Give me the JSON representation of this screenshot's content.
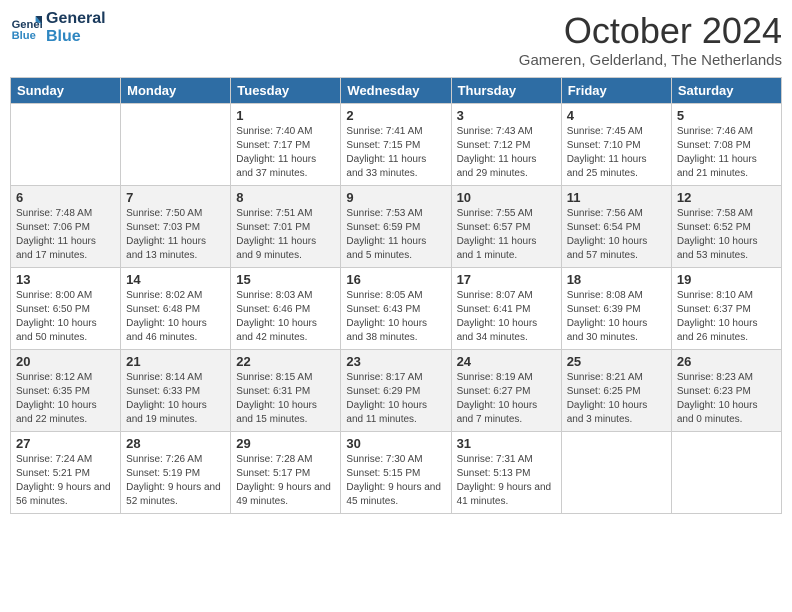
{
  "header": {
    "logo_line1": "General",
    "logo_line2": "Blue",
    "month": "October 2024",
    "location": "Gameren, Gelderland, The Netherlands"
  },
  "days_of_week": [
    "Sunday",
    "Monday",
    "Tuesday",
    "Wednesday",
    "Thursday",
    "Friday",
    "Saturday"
  ],
  "weeks": [
    [
      {
        "day": "",
        "info": ""
      },
      {
        "day": "",
        "info": ""
      },
      {
        "day": "1",
        "info": "Sunrise: 7:40 AM\nSunset: 7:17 PM\nDaylight: 11 hours and 37 minutes."
      },
      {
        "day": "2",
        "info": "Sunrise: 7:41 AM\nSunset: 7:15 PM\nDaylight: 11 hours and 33 minutes."
      },
      {
        "day": "3",
        "info": "Sunrise: 7:43 AM\nSunset: 7:12 PM\nDaylight: 11 hours and 29 minutes."
      },
      {
        "day": "4",
        "info": "Sunrise: 7:45 AM\nSunset: 7:10 PM\nDaylight: 11 hours and 25 minutes."
      },
      {
        "day": "5",
        "info": "Sunrise: 7:46 AM\nSunset: 7:08 PM\nDaylight: 11 hours and 21 minutes."
      }
    ],
    [
      {
        "day": "6",
        "info": "Sunrise: 7:48 AM\nSunset: 7:06 PM\nDaylight: 11 hours and 17 minutes."
      },
      {
        "day": "7",
        "info": "Sunrise: 7:50 AM\nSunset: 7:03 PM\nDaylight: 11 hours and 13 minutes."
      },
      {
        "day": "8",
        "info": "Sunrise: 7:51 AM\nSunset: 7:01 PM\nDaylight: 11 hours and 9 minutes."
      },
      {
        "day": "9",
        "info": "Sunrise: 7:53 AM\nSunset: 6:59 PM\nDaylight: 11 hours and 5 minutes."
      },
      {
        "day": "10",
        "info": "Sunrise: 7:55 AM\nSunset: 6:57 PM\nDaylight: 11 hours and 1 minute."
      },
      {
        "day": "11",
        "info": "Sunrise: 7:56 AM\nSunset: 6:54 PM\nDaylight: 10 hours and 57 minutes."
      },
      {
        "day": "12",
        "info": "Sunrise: 7:58 AM\nSunset: 6:52 PM\nDaylight: 10 hours and 53 minutes."
      }
    ],
    [
      {
        "day": "13",
        "info": "Sunrise: 8:00 AM\nSunset: 6:50 PM\nDaylight: 10 hours and 50 minutes."
      },
      {
        "day": "14",
        "info": "Sunrise: 8:02 AM\nSunset: 6:48 PM\nDaylight: 10 hours and 46 minutes."
      },
      {
        "day": "15",
        "info": "Sunrise: 8:03 AM\nSunset: 6:46 PM\nDaylight: 10 hours and 42 minutes."
      },
      {
        "day": "16",
        "info": "Sunrise: 8:05 AM\nSunset: 6:43 PM\nDaylight: 10 hours and 38 minutes."
      },
      {
        "day": "17",
        "info": "Sunrise: 8:07 AM\nSunset: 6:41 PM\nDaylight: 10 hours and 34 minutes."
      },
      {
        "day": "18",
        "info": "Sunrise: 8:08 AM\nSunset: 6:39 PM\nDaylight: 10 hours and 30 minutes."
      },
      {
        "day": "19",
        "info": "Sunrise: 8:10 AM\nSunset: 6:37 PM\nDaylight: 10 hours and 26 minutes."
      }
    ],
    [
      {
        "day": "20",
        "info": "Sunrise: 8:12 AM\nSunset: 6:35 PM\nDaylight: 10 hours and 22 minutes."
      },
      {
        "day": "21",
        "info": "Sunrise: 8:14 AM\nSunset: 6:33 PM\nDaylight: 10 hours and 19 minutes."
      },
      {
        "day": "22",
        "info": "Sunrise: 8:15 AM\nSunset: 6:31 PM\nDaylight: 10 hours and 15 minutes."
      },
      {
        "day": "23",
        "info": "Sunrise: 8:17 AM\nSunset: 6:29 PM\nDaylight: 10 hours and 11 minutes."
      },
      {
        "day": "24",
        "info": "Sunrise: 8:19 AM\nSunset: 6:27 PM\nDaylight: 10 hours and 7 minutes."
      },
      {
        "day": "25",
        "info": "Sunrise: 8:21 AM\nSunset: 6:25 PM\nDaylight: 10 hours and 3 minutes."
      },
      {
        "day": "26",
        "info": "Sunrise: 8:23 AM\nSunset: 6:23 PM\nDaylight: 10 hours and 0 minutes."
      }
    ],
    [
      {
        "day": "27",
        "info": "Sunrise: 7:24 AM\nSunset: 5:21 PM\nDaylight: 9 hours and 56 minutes."
      },
      {
        "day": "28",
        "info": "Sunrise: 7:26 AM\nSunset: 5:19 PM\nDaylight: 9 hours and 52 minutes."
      },
      {
        "day": "29",
        "info": "Sunrise: 7:28 AM\nSunset: 5:17 PM\nDaylight: 9 hours and 49 minutes."
      },
      {
        "day": "30",
        "info": "Sunrise: 7:30 AM\nSunset: 5:15 PM\nDaylight: 9 hours and 45 minutes."
      },
      {
        "day": "31",
        "info": "Sunrise: 7:31 AM\nSunset: 5:13 PM\nDaylight: 9 hours and 41 minutes."
      },
      {
        "day": "",
        "info": ""
      },
      {
        "day": "",
        "info": ""
      }
    ]
  ]
}
